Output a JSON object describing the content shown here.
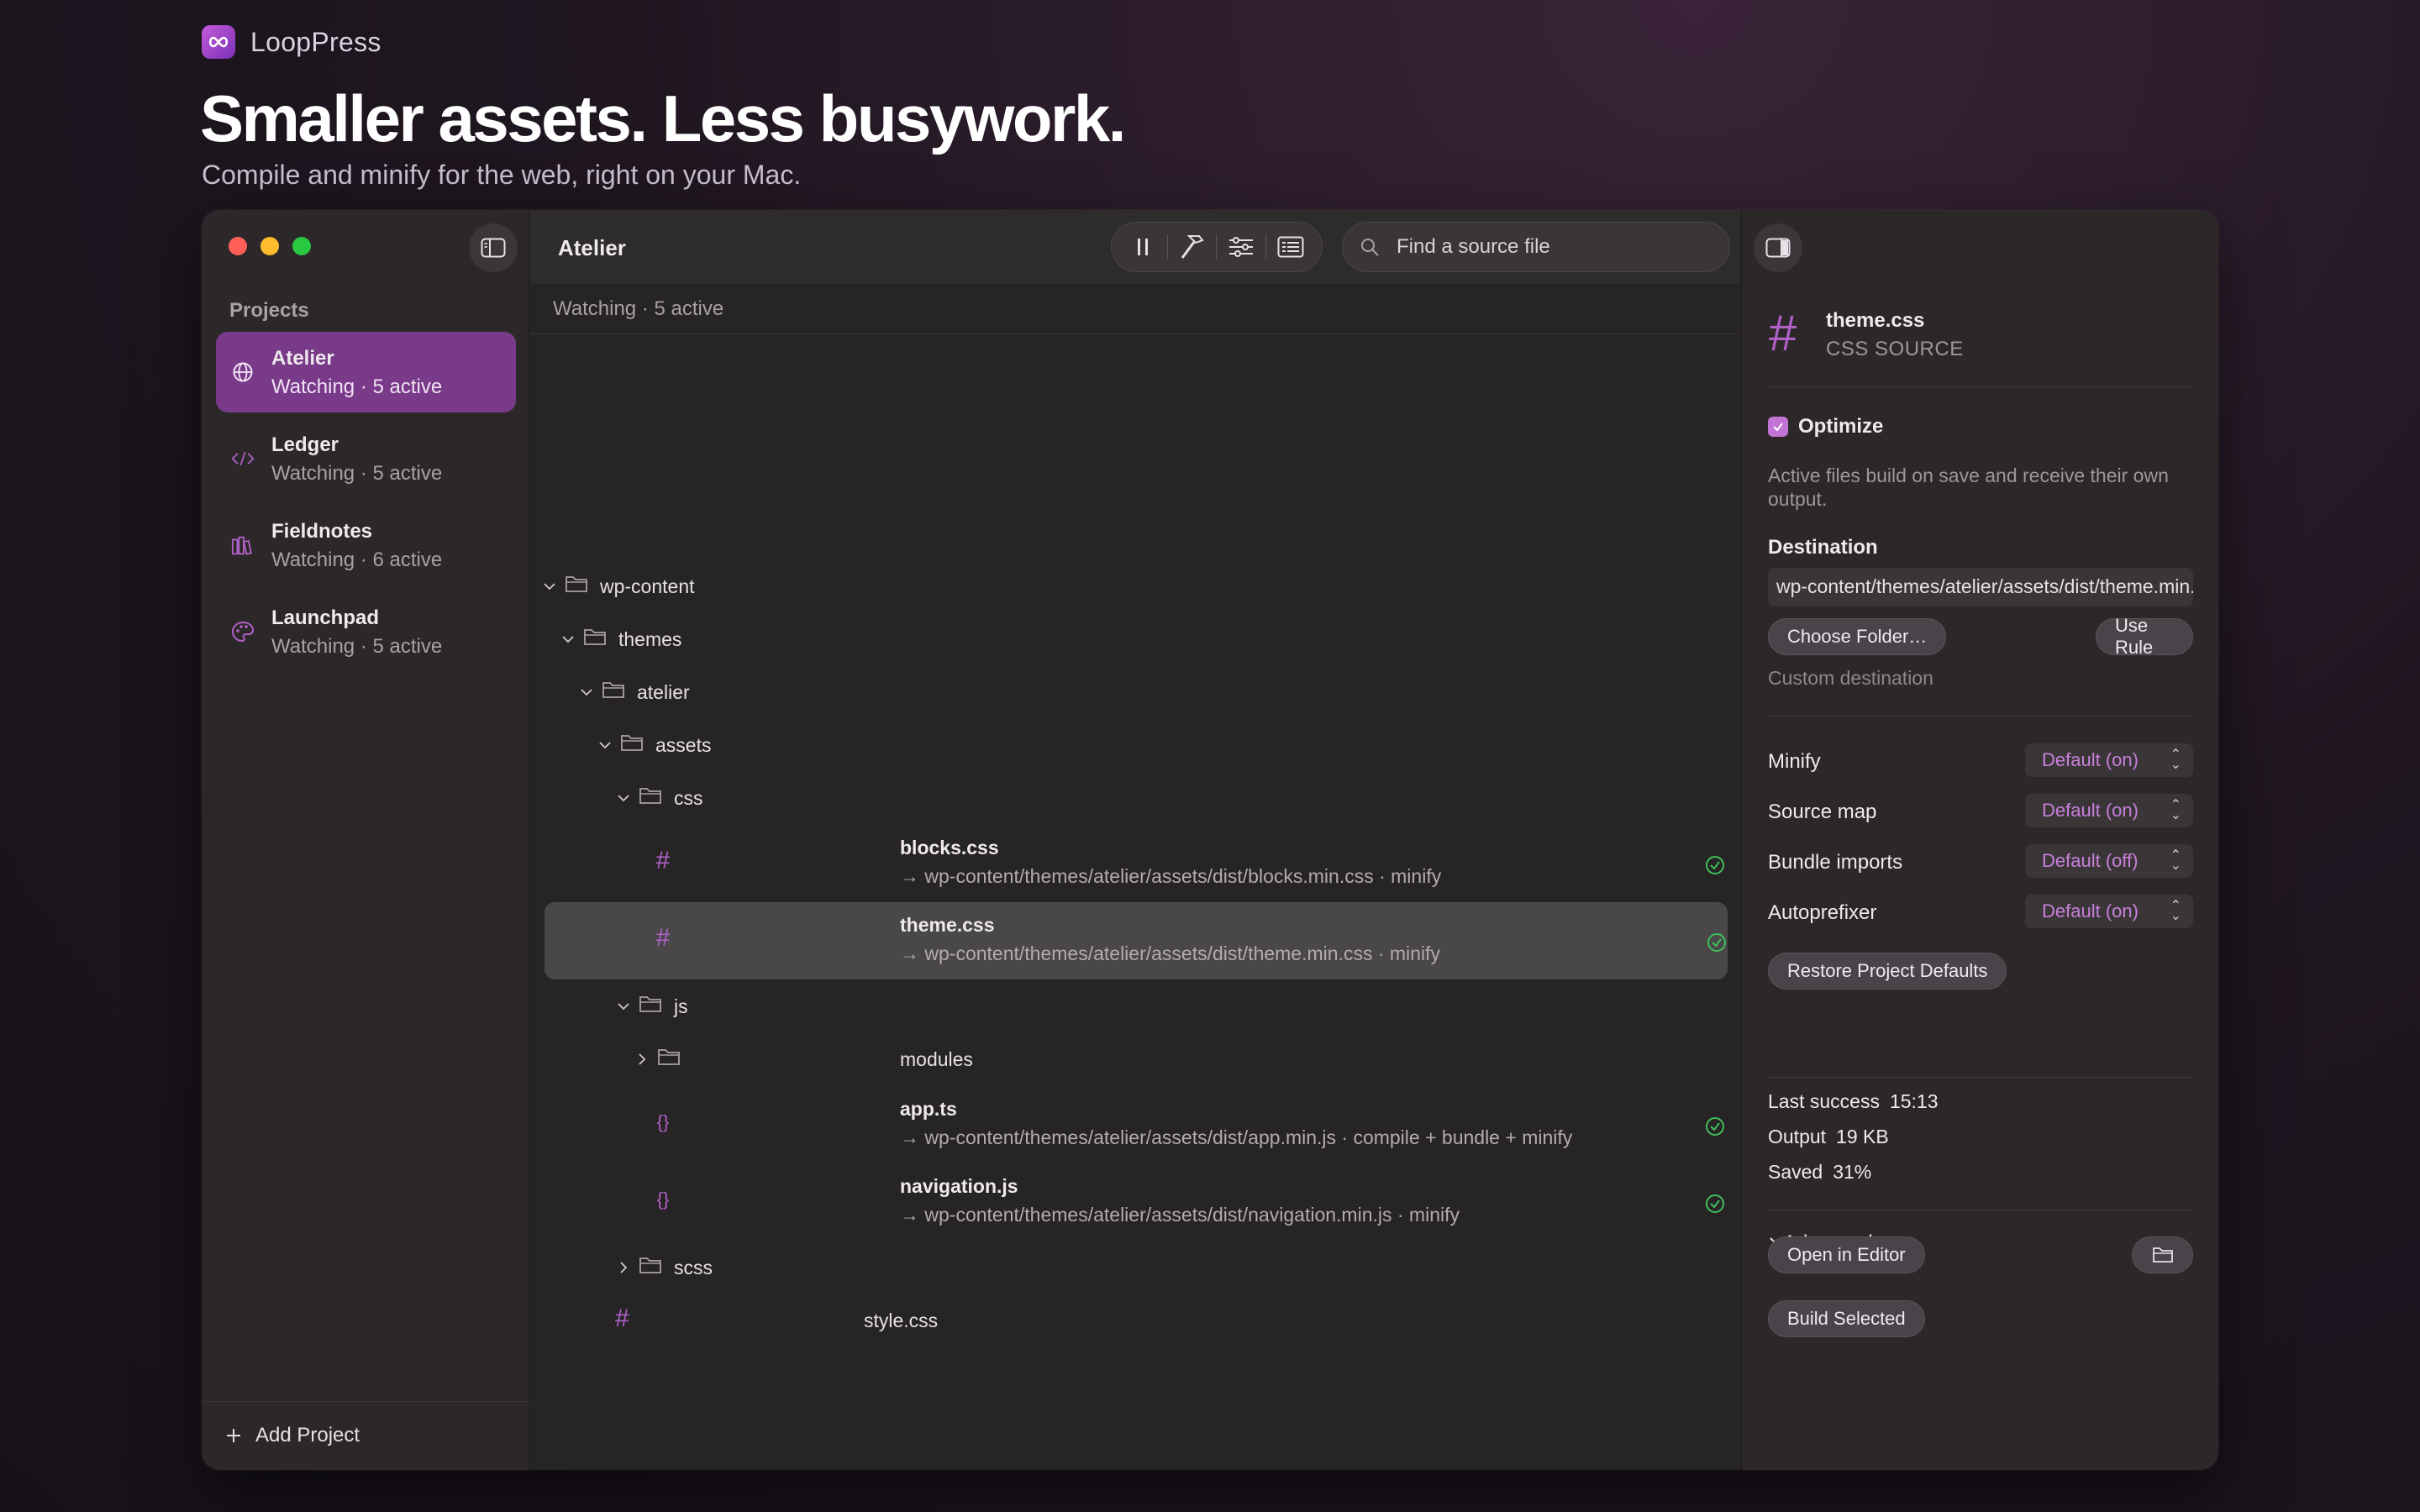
{
  "brand": {
    "name": "LoopPress"
  },
  "hero": {
    "title": "Smaller assets. Less busywork.",
    "subtitle": "Compile and minify for the web, right on your Mac."
  },
  "colors": {
    "accent": "#b061c8",
    "active_row": "#7a3a8a",
    "close": "#ff5f57",
    "minimize": "#febc2e",
    "zoom": "#28c840",
    "success": "#3fbf5a"
  },
  "sidebar": {
    "heading": "Projects",
    "projects": [
      {
        "name": "Atelier",
        "status": "Watching · 5 active",
        "icon": "globe-icon",
        "active": true
      },
      {
        "name": "Ledger",
        "status": "Watching · 5 active",
        "icon": "code-icon",
        "active": false
      },
      {
        "name": "Fieldnotes",
        "status": "Watching · 6 active",
        "icon": "books-icon",
        "active": false
      },
      {
        "name": "Launchpad",
        "status": "Watching · 5 active",
        "icon": "palette-icon",
        "active": false
      }
    ],
    "add_label": "Add Project"
  },
  "main": {
    "title": "Atelier",
    "search_placeholder": "Find a source file",
    "status": "Watching · 5 active",
    "tree": {
      "wp_content": "wp-content",
      "themes": "themes",
      "atelier": "atelier",
      "assets": "assets",
      "css": "css",
      "js": "js",
      "modules": "modules",
      "scss": "scss",
      "style": "style.css"
    },
    "files": [
      {
        "name": "blocks.css",
        "dest": "→ wp-content/themes/atelier/assets/dist/blocks.min.css · minify",
        "icon": "#"
      },
      {
        "name": "theme.css",
        "dest": "→ wp-content/themes/atelier/assets/dist/theme.min.css · minify",
        "icon": "#"
      },
      {
        "name": "app.ts",
        "dest": "→ wp-content/themes/atelier/assets/dist/app.min.js · compile + bundle + minify",
        "icon": "{}"
      },
      {
        "name": "navigation.js",
        "dest": "→ wp-content/themes/atelier/assets/dist/navigation.min.js · minify",
        "icon": "{}"
      }
    ]
  },
  "inspector": {
    "file_name": "theme.css",
    "file_kind": "CSS SOURCE",
    "optimize_label": "Optimize",
    "help": "Active files build on save and receive their own output.",
    "destination_label": "Destination",
    "destination_value": "wp-content/themes/atelier/assets/dist/theme.min.css",
    "choose_folder": "Choose Folder…",
    "use_rule": "Use Rule",
    "custom_destination": "Custom destination",
    "settings": [
      {
        "label": "Minify",
        "value": "Default (on)"
      },
      {
        "label": "Source map",
        "value": "Default (on)"
      },
      {
        "label": "Bundle imports",
        "value": "Default (off)"
      },
      {
        "label": "Autoprefixer",
        "value": "Default (on)"
      }
    ],
    "restore": "Restore Project Defaults",
    "advanced": "Advanced",
    "stats": [
      {
        "label": "Last success",
        "value": "15:13"
      },
      {
        "label": "Output",
        "value": "19 KB"
      },
      {
        "label": "Saved",
        "value": "31%"
      }
    ],
    "open_editor": "Open in Editor",
    "build_selected": "Build Selected"
  }
}
